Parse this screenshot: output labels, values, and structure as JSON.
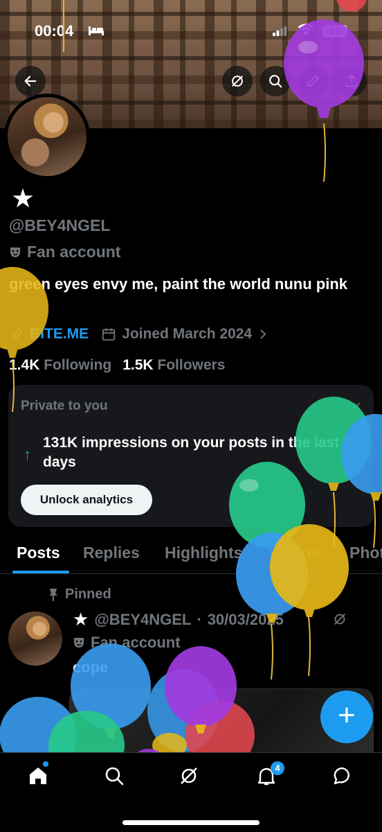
{
  "status_bar": {
    "time": "00:04",
    "battery": "23"
  },
  "profile": {
    "display_name": "★",
    "handle": "@BEY4NGEL",
    "category": "Fan account",
    "bio": "green eyes envy me, paint the world nunu pink",
    "link": "BITE.ME",
    "joined": "Joined March 2024",
    "following_count": "1.4K",
    "following_label": "Following",
    "followers_count": "1.5K",
    "followers_label": "Followers"
  },
  "analytics_card": {
    "title": "Private to you",
    "close": "×",
    "text": "131K impressions on your posts in the last 7 days",
    "button": "Unlock analytics"
  },
  "tabs": [
    "Posts",
    "Replies",
    "Highlights",
    "Videos",
    "Photos"
  ],
  "active_tab": "Posts",
  "pinned_post": {
    "pinned_label": "Pinned",
    "author_star": "★",
    "handle": "@BEY4NGEL",
    "separator": "·",
    "date": "30/03/2025",
    "category": "Fan account",
    "text": "cope"
  },
  "fab_label": "+",
  "bottom_nav": {
    "items": [
      "home-icon",
      "search-icon",
      "grok-icon",
      "notifications-icon",
      "messages-icon"
    ],
    "notifications_badge": "4"
  },
  "colors": {
    "accent": "#1d9bf0",
    "green": "#00ba7c",
    "muted": "#71767b",
    "background": "#000000"
  }
}
